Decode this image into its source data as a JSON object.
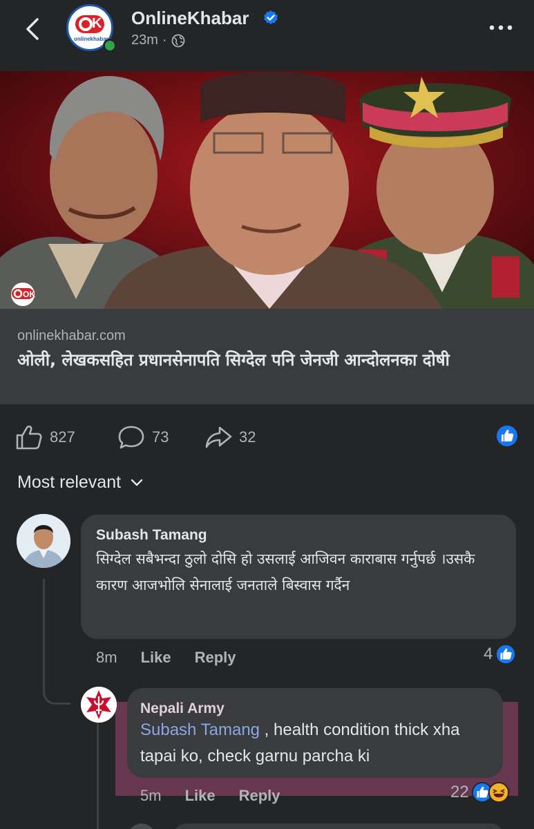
{
  "header": {
    "page_name": "OnlineKhabar",
    "time": "23m",
    "dot": "·",
    "avatar_text": "onlinekhabar",
    "avatar_logo": "OK"
  },
  "hero": {
    "logo_text": "OK",
    "logo_sub": "onlinekhabar"
  },
  "link": {
    "domain": "onlinekhabar.com",
    "title": "ओली, लेखकसहित प्रधानसेनापति सिग्देल पनि जेनजी आन्दोलनका दोषी"
  },
  "actions": {
    "likes": "827",
    "comments": "73",
    "shares": "32"
  },
  "sort": {
    "label": "Most relevant"
  },
  "comments": [
    {
      "author": "Subash Tamang",
      "text": "सिग्देल सबैभन्दा ठुलो दोसि हो उसलाई आजिवन काराबास गर्नुपर्छ ।उसकै कारण आजभोलि सेनालाई जनताले बिस्वास गर्दैन",
      "time": "8m",
      "like_label": "Like",
      "reply_label": "Reply",
      "reaction_count": "4"
    },
    {
      "author": "Nepali Army",
      "mention": "Subash Tamang",
      "text": " , health condition thick xha tapai ko, check garnu parcha ki",
      "time": "5m",
      "like_label": "Like",
      "reply_label": "Reply",
      "reaction_count": "22"
    }
  ],
  "colors": {
    "background": "#242526",
    "bubble": "#3a3b3c",
    "facebook_blue": "#1877f2",
    "highlight": "#b84e82"
  }
}
